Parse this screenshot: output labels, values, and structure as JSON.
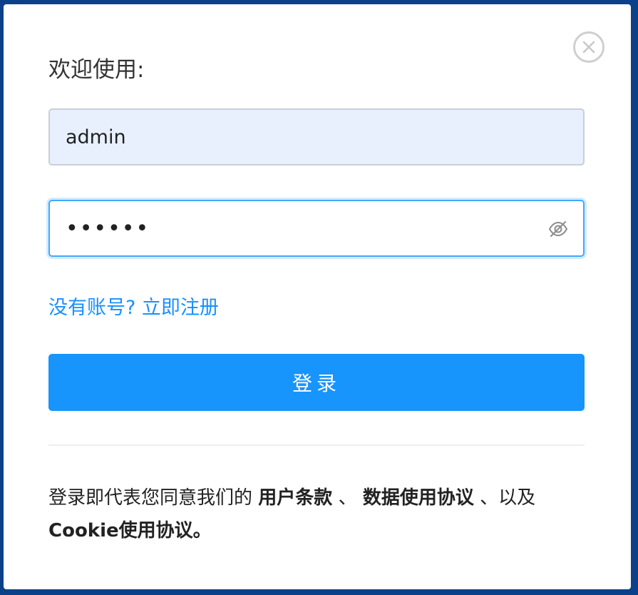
{
  "dialog": {
    "title": "欢迎使用:",
    "close_icon": "close-circle-icon"
  },
  "form": {
    "username_value": "admin",
    "password_value": "••••••",
    "password_toggle_icon": "eye-invisible-icon",
    "register_link": "没有账号? 立即注册",
    "login_label": "登录"
  },
  "terms": {
    "prefix": "登录即代表您同意我们的",
    "user_terms": "用户条款",
    "sep1": "、",
    "data_agreement": "数据使用协议",
    "sep2": "、以及",
    "cookie_agreement": "Cookie使用协议。"
  },
  "colors": {
    "backdrop": "#0a4189",
    "primary": "#1894fd",
    "link": "#1890ff",
    "username_bg": "#e8f0fe"
  }
}
